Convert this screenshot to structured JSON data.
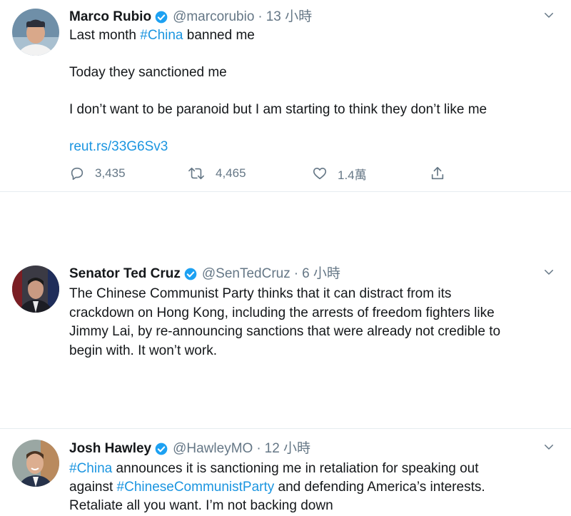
{
  "tweets": [
    {
      "name": "Marco Rubio",
      "handle": "@marcorubio",
      "time": "13 小時",
      "text": {
        "p1_pre": "Last month ",
        "p1_tag": "#China",
        "p1_post": " banned me",
        "p2": "Today they sanctioned me",
        "p3": "I don’t want to be paranoid but I am starting to think they don’t like me",
        "link": "reut.rs/33G6Sv3"
      },
      "actions": {
        "reply_count": "3,435",
        "retweet_count": "4,465",
        "like_count": "1.4萬"
      }
    },
    {
      "name": "Senator Ted Cruz",
      "handle": "@SenTedCruz",
      "time": "6 小時",
      "text": {
        "line1": "The Chinese Communist Party thinks that it can distract from its",
        "line2": "crackdown on Hong Kong, including the arrests of freedom fighters like",
        "line3": "Jimmy Lai, by re-announcing sanctions that were already not credible to",
        "line4": "begin with. It won’t work."
      }
    },
    {
      "name": "Josh Hawley",
      "handle": "@HawleyMO",
      "time": "12 小時",
      "text": {
        "tag1": "#China",
        "l1_post": " announces it is sanctioning me in retaliation for speaking out",
        "l2_pre": "against ",
        "tag2": "#ChineseCommunistParty",
        "l2_post": " and defending America’s interests.",
        "line3": "Retaliate all you want. I’m not backing down"
      }
    }
  ],
  "colors": {
    "link": "#1b95e0",
    "secondary": "#657786",
    "verified": "#1da1f2",
    "divider": "#e6ecf0"
  },
  "icons": [
    "verified-badge-icon",
    "chevron-down-icon",
    "reply-icon",
    "retweet-icon",
    "like-icon",
    "share-icon"
  ]
}
